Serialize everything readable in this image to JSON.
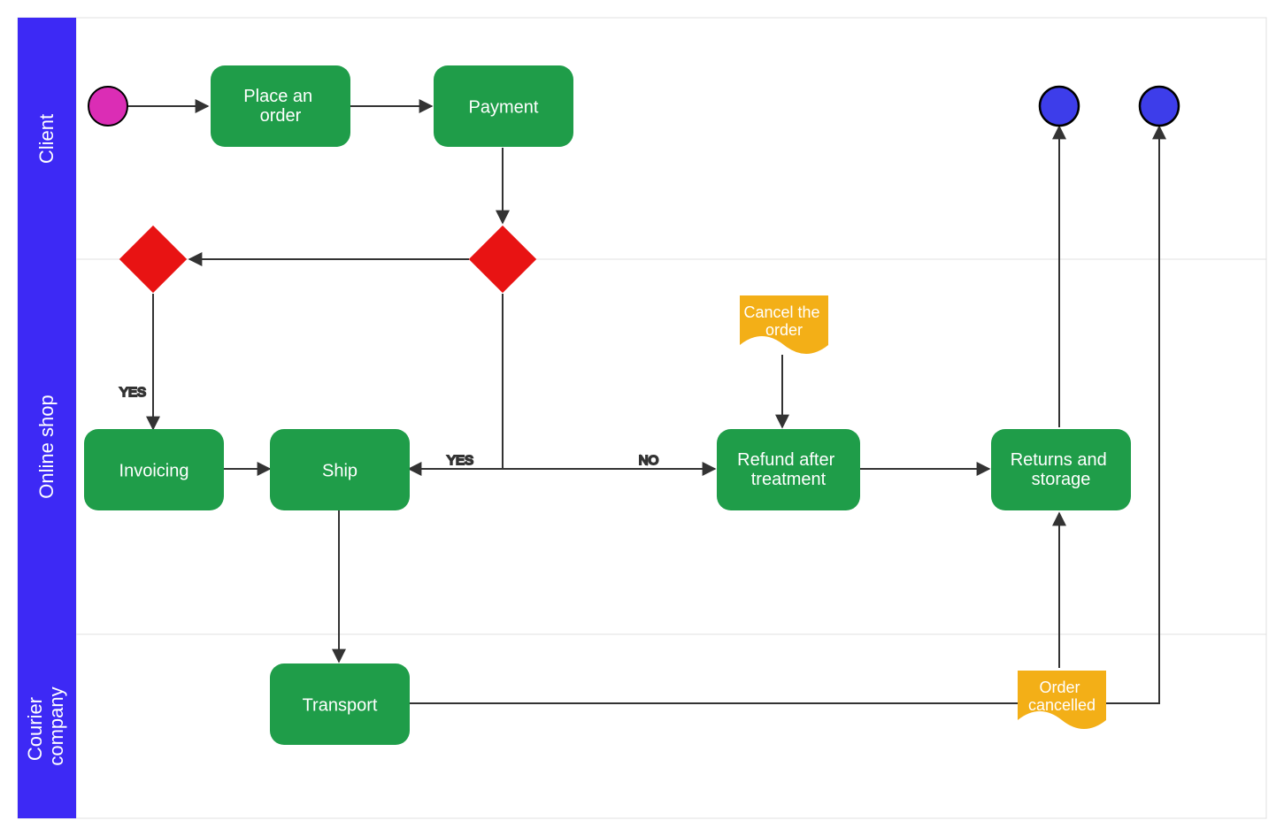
{
  "lanes": {
    "client": "Client",
    "shop": "Online shop",
    "courier": "Courier company"
  },
  "tasks": {
    "place_order": "Place an order",
    "payment": "Payment",
    "invoicing": "Invoicing",
    "ship": "Ship",
    "refund": "Refund after treatment",
    "returns": "Returns and storage",
    "transport": "Transport"
  },
  "notes": {
    "cancel": "Cancel the order",
    "cancelled": "Order cancelled"
  },
  "edges": {
    "yes1": "YES",
    "yes2": "YES",
    "no": "NO"
  },
  "colors": {
    "lane_header": "#3D29F5",
    "task": "#1F9D49",
    "gateway": "#E81313",
    "note": "#F3AF17",
    "start": "#DB2DB5",
    "end": "#3D3DEA",
    "stroke": "#333333",
    "lane_border": "#E0E0E0"
  }
}
